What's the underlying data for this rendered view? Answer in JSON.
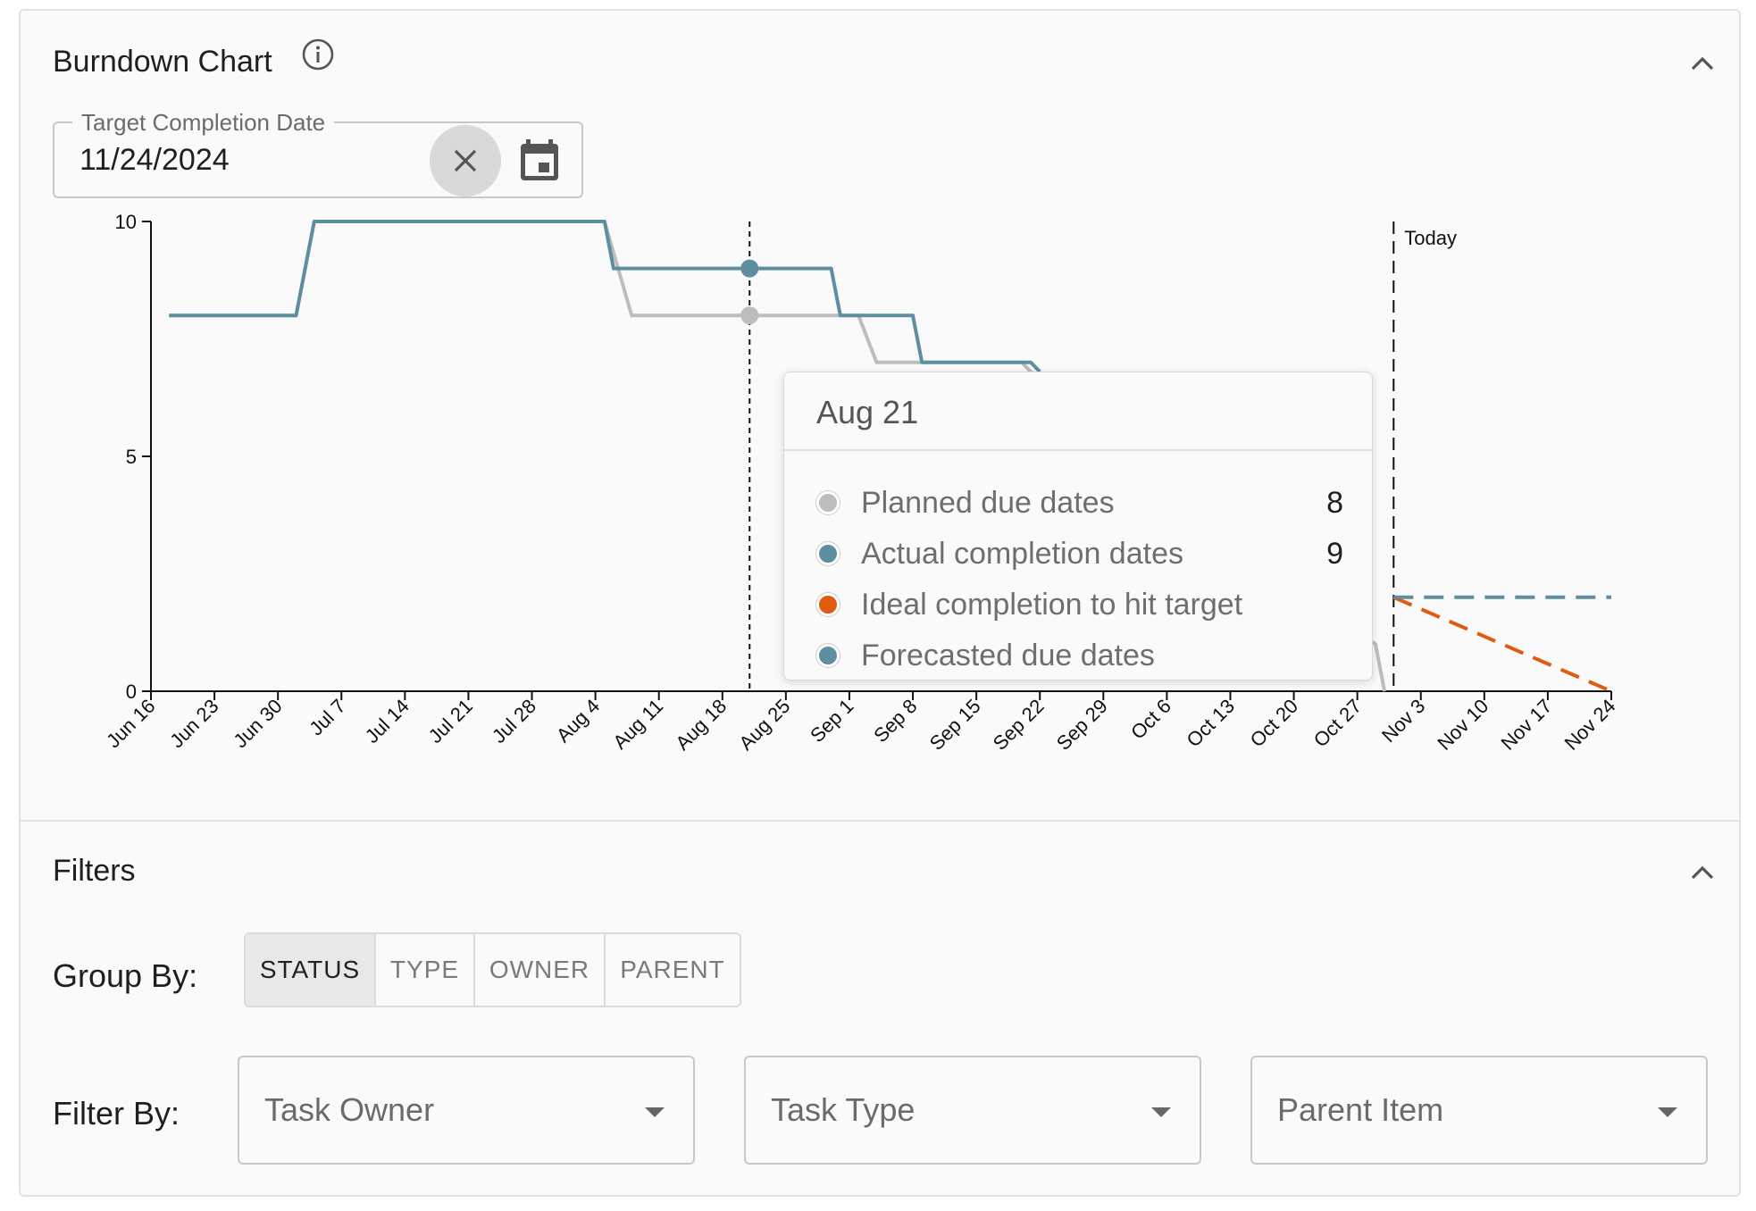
{
  "chart_panel": {
    "title": "Burndown Chart",
    "target_date": {
      "label": "Target Completion Date",
      "value": "11/24/2024"
    }
  },
  "chart_data": {
    "type": "line",
    "x_ticks": [
      "Jun 16",
      "Jun 23",
      "Jun 30",
      "Jul 7",
      "Jul 14",
      "Jul 21",
      "Jul 28",
      "Aug 4",
      "Aug 11",
      "Aug 18",
      "Aug 25",
      "Sep 1",
      "Sep 8",
      "Sep 15",
      "Sep 22",
      "Sep 29",
      "Oct 6",
      "Oct 13",
      "Oct 20",
      "Oct 27",
      "Nov 3",
      "Nov 10",
      "Nov 17",
      "Nov 24"
    ],
    "y_ticks": [
      0,
      5,
      10
    ],
    "ylim": [
      0,
      10
    ],
    "xlim": [
      "2024-06-16",
      "2024-11-24"
    ],
    "today_label": "Today",
    "today_date": "2024-10-31",
    "hover_date": "2024-08-21",
    "series": [
      {
        "name": "Planned due dates",
        "color": "#bdbdbd",
        "style": "solid",
        "points": [
          [
            "2024-06-18",
            8
          ],
          [
            "2024-07-02",
            8
          ],
          [
            "2024-07-04",
            10
          ],
          [
            "2024-08-05",
            10
          ],
          [
            "2024-08-08",
            8
          ],
          [
            "2024-09-02",
            8
          ],
          [
            "2024-09-04",
            7
          ],
          [
            "2024-09-20",
            7
          ],
          [
            "2024-09-21",
            6.8
          ],
          [
            "2024-10-29",
            1
          ],
          [
            "2024-10-30",
            0
          ]
        ]
      },
      {
        "name": "Actual completion dates",
        "color": "#5e8fa0",
        "style": "solid",
        "points": [
          [
            "2024-06-18",
            8
          ],
          [
            "2024-07-02",
            8
          ],
          [
            "2024-07-04",
            10
          ],
          [
            "2024-08-05",
            10
          ],
          [
            "2024-08-06",
            9
          ],
          [
            "2024-08-30",
            9
          ],
          [
            "2024-08-31",
            8
          ],
          [
            "2024-09-08",
            8
          ],
          [
            "2024-09-09",
            7
          ],
          [
            "2024-09-21",
            7
          ],
          [
            "2024-09-22",
            6.8
          ]
        ]
      },
      {
        "name": "Ideal completion to hit target",
        "color": "#e05a10",
        "style": "dashed",
        "points": [
          [
            "2024-10-31",
            2
          ],
          [
            "2024-11-24",
            0
          ]
        ]
      },
      {
        "name": "Forecasted due dates",
        "color": "#5e8fa0",
        "style": "dashed",
        "points": [
          [
            "2024-10-31",
            2
          ],
          [
            "2024-11-24",
            2
          ]
        ]
      }
    ]
  },
  "tooltip": {
    "date": "Aug 21",
    "rows": [
      {
        "name": "Planned due dates",
        "value": "8",
        "color": "#bdbdbd"
      },
      {
        "name": "Actual completion dates",
        "value": "9",
        "color": "#5e8fa0"
      },
      {
        "name": "Ideal completion to hit target",
        "value": "",
        "color": "#e05a10"
      },
      {
        "name": "Forecasted due dates",
        "value": "",
        "color": "#5e8fa0"
      }
    ]
  },
  "filters": {
    "title": "Filters",
    "group_by": {
      "label": "Group By:",
      "options": [
        "STATUS",
        "TYPE",
        "OWNER",
        "PARENT"
      ],
      "selected": "STATUS"
    },
    "filter_by": {
      "label": "Filter By:",
      "selects": [
        "Task Owner",
        "Task Type",
        "Parent Item"
      ]
    }
  },
  "icons": [
    "info-icon",
    "chevron-up-icon",
    "close-icon",
    "calendar-icon",
    "dropdown-caret-icon"
  ]
}
